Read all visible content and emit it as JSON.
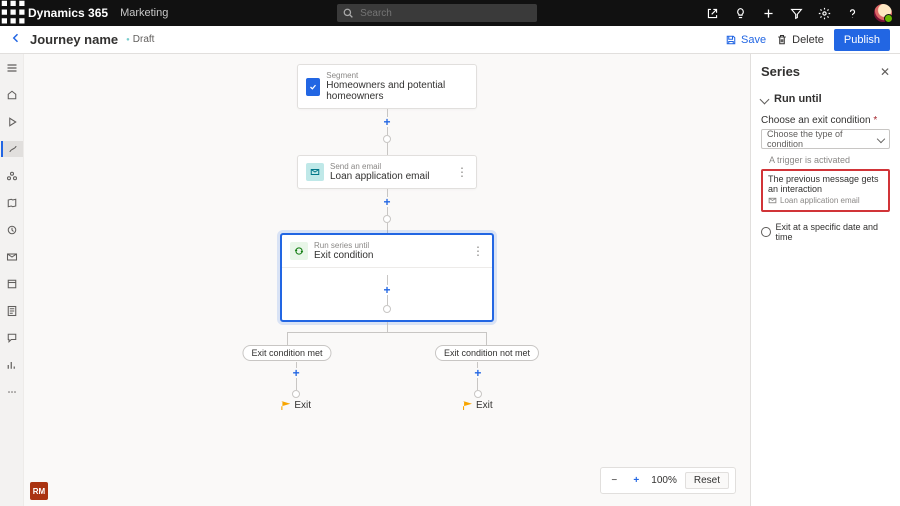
{
  "topbar": {
    "brand": "Dynamics 365",
    "module": "Marketing",
    "search_placeholder": "Search"
  },
  "cmdbar": {
    "title": "Journey name",
    "status": "Draft",
    "save": "Save",
    "delete": "Delete",
    "publish": "Publish"
  },
  "flow": {
    "segment_sup": "Segment",
    "segment_main": "Homeowners and potential homeowners",
    "email_sup": "Send an email",
    "email_main": "Loan application email",
    "series_sup": "Run series until",
    "series_main": "Exit condition",
    "branch_left": "Exit condition met",
    "branch_right": "Exit condition not met",
    "exit_label": "Exit"
  },
  "zoom": {
    "level": "100%",
    "reset": "Reset"
  },
  "panel": {
    "title": "Series",
    "section": "Run until",
    "field_label": "Choose an exit condition",
    "dropdown_placeholder": "Choose the type of condition",
    "opt_trigger": "A trigger is activated",
    "opt_interaction": "The previous message gets an interaction",
    "opt_interaction_sub": "Loan application email",
    "radio_datetime": "Exit at a specific date and time"
  },
  "corner_badge": "RM"
}
